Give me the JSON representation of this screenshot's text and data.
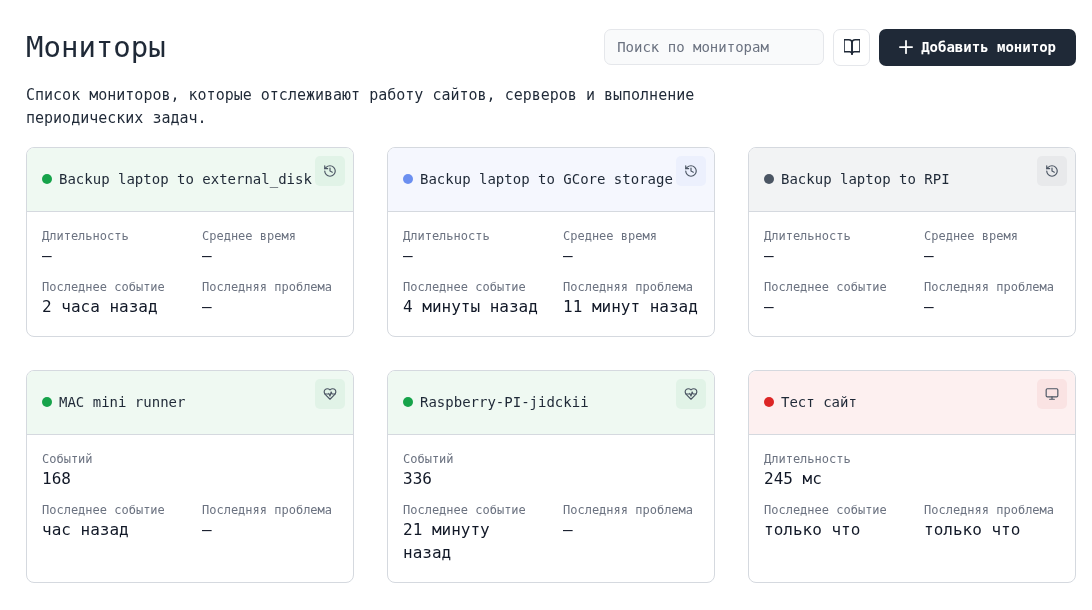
{
  "page": {
    "title": "Мониторы",
    "description": "Список мониторов, которые отслеживают работу сайтов, серверов и выполнение периодических задач.",
    "search": {
      "placeholder": "Поиск по мониторам"
    },
    "add_button": {
      "label": "Добавить монитор"
    }
  },
  "monitors": [
    {
      "name": "Backup laptop to external_disk",
      "color": "#16a34a",
      "kind": "cron",
      "rows": [
        [
          {
            "label": "Длительность",
            "value": "—"
          },
          {
            "label": "Среднее время",
            "value": "—"
          }
        ],
        [
          {
            "label": "Последнее событие",
            "value": "2 часа назад"
          },
          {
            "label": "Последняя проблема",
            "value": "—"
          }
        ]
      ]
    },
    {
      "name": "Backup laptop to GCore storage",
      "color": "#6b8ff0",
      "kind": "cron",
      "rows": [
        [
          {
            "label": "Длительность",
            "value": "—"
          },
          {
            "label": "Среднее время",
            "value": "—"
          }
        ],
        [
          {
            "label": "Последнее событие",
            "value": "4 минуты назад"
          },
          {
            "label": "Последняя проблема",
            "value": "11 минут назад"
          }
        ]
      ]
    },
    {
      "name": "Backup laptop to RPI",
      "color": "#4b5563",
      "kind": "cron",
      "rows": [
        [
          {
            "label": "Длительность",
            "value": "—"
          },
          {
            "label": "Среднее время",
            "value": "—"
          }
        ],
        [
          {
            "label": "Последнее событие",
            "value": "—"
          },
          {
            "label": "Последняя проблема",
            "value": "—"
          }
        ]
      ]
    },
    {
      "name": "MAC mini runner",
      "color": "#16a34a",
      "kind": "heartbeat",
      "rows": [
        [
          {
            "label": "Событий",
            "value": "168"
          }
        ],
        [
          {
            "label": "Последнее событие",
            "value": "час назад"
          },
          {
            "label": "Последняя проблема",
            "value": "—"
          }
        ]
      ]
    },
    {
      "name": "Raspberry-PI-jidckii",
      "color": "#16a34a",
      "kind": "heartbeat",
      "rows": [
        [
          {
            "label": "Событий",
            "value": "336"
          }
        ],
        [
          {
            "label": "Последнее событие",
            "value": "21 минуту назад"
          },
          {
            "label": "Последняя проблема",
            "value": "—"
          }
        ]
      ]
    },
    {
      "name": "Тест сайт",
      "color": "#dc2626",
      "kind": "http",
      "rows": [
        [
          {
            "label": "Длительность",
            "value": "245 мс"
          }
        ],
        [
          {
            "label": "Последнее событие",
            "value": "только что"
          },
          {
            "label": "Последняя проблема",
            "value": "только что"
          }
        ]
      ]
    }
  ]
}
